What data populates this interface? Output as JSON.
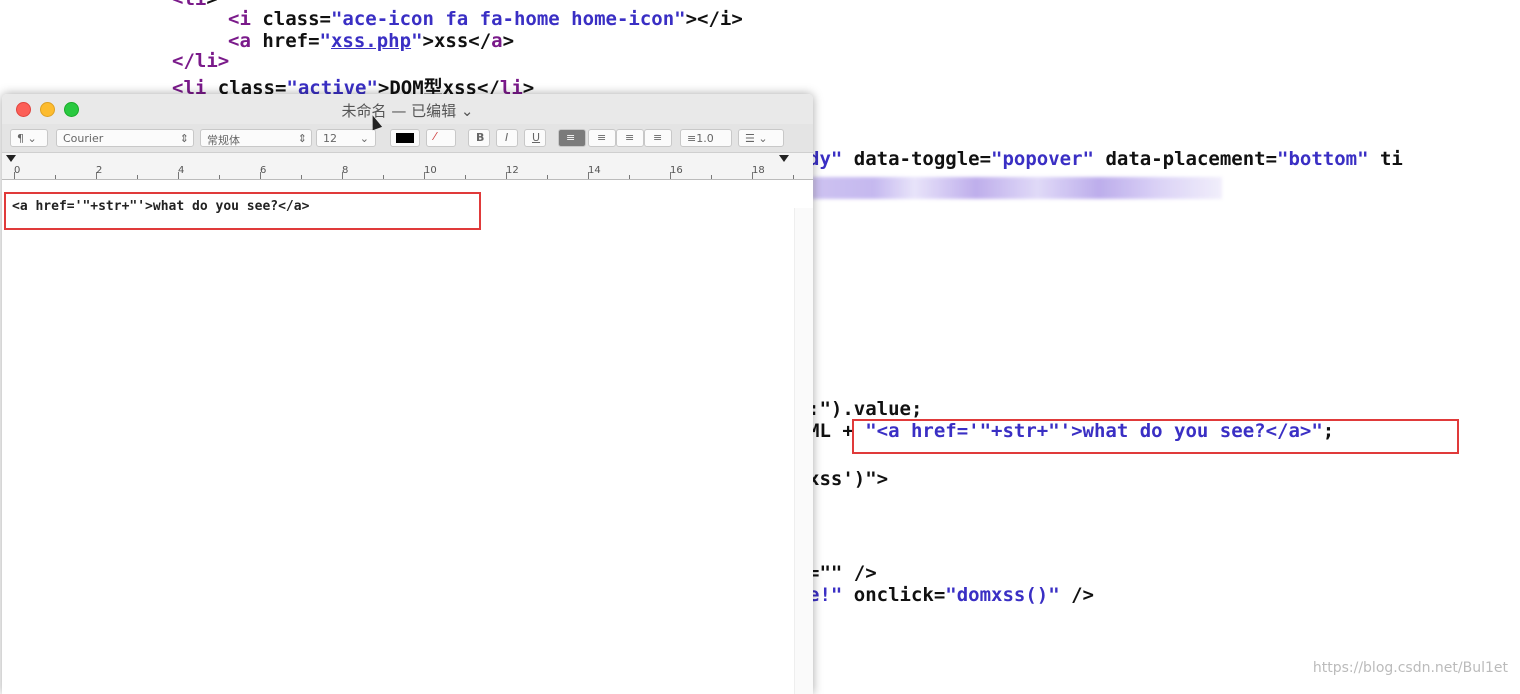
{
  "background_code": {
    "line1": {
      "tag_open": "<i ",
      "attr": "class=",
      "val": "\"ace-icon fa fa-home home-icon\"",
      "close": "></i>"
    },
    "line2": {
      "tag_open": "<a ",
      "attr": "href=",
      "q1": "\"",
      "link": "xss.php",
      "q2": "\"",
      "text": ">xss</",
      "tag_close": "a",
      "end": ">"
    },
    "line3": "</li>",
    "line4": {
      "tag_open": "<li ",
      "attr": "class=",
      "val": "\"active\"",
      "text": ">DOM型xss</",
      "tag": "li",
      "end": ">"
    },
    "line5": {
      "pre": "dy\"",
      "attr1": " data-toggle=",
      "val1": "\"popover\"",
      "attr2": " data-placement=",
      "val2": "\"bottom\"",
      "tail": " ti"
    },
    "line6": ":\").value;",
    "line7": {
      "pre": "ML + ",
      "val": "\"<a href='\"+str+\"'>what do you see?</a>\"",
      "end": ";"
    },
    "line8": "xss')\">",
    "line9": "=\"\" />",
    "line10": {
      "pre": "e!\"",
      "attr": " onclick=",
      "val": "\"domxss()\"",
      "end": " />"
    }
  },
  "editor": {
    "title": "未命名 — 已编辑",
    "title_chevron": "⌄",
    "toolbar": {
      "paragraph": "¶",
      "font": "Courier",
      "style": "常规体",
      "size": "12",
      "spacing": "1.0",
      "bold": "B",
      "italic": "I",
      "underline": "U"
    },
    "ruler_numbers": [
      "0",
      "2",
      "4",
      "6",
      "8",
      "10",
      "12",
      "14",
      "16",
      "18"
    ],
    "content": "<a href='\"+str+\"'>what do you see?</a>"
  },
  "watermark": "https://blog.csdn.net/Bul1et",
  "colors": {
    "highlight_box": "#e03a3a",
    "tag": "#7a1a8a",
    "string": "#3a2fc4"
  }
}
